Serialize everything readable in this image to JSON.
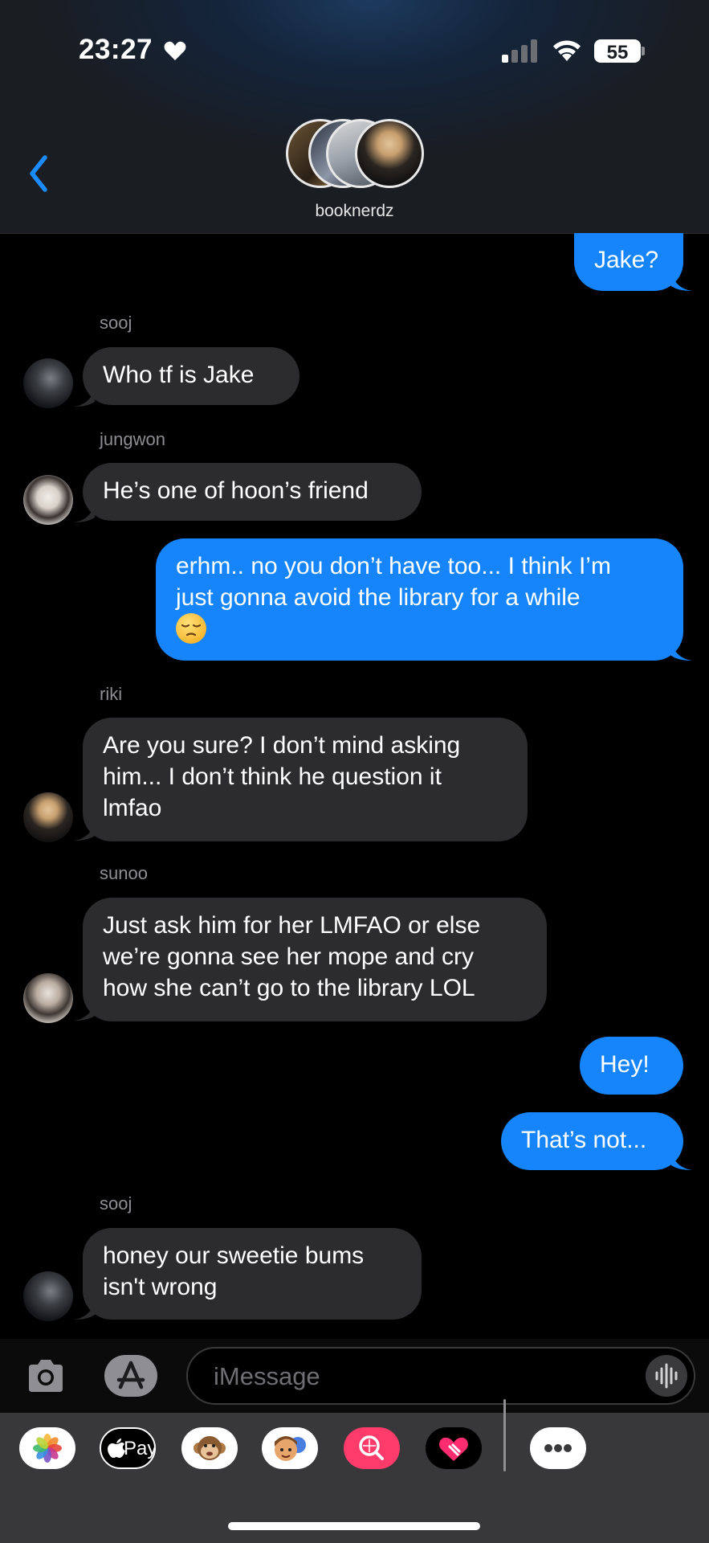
{
  "status_bar": {
    "time": "23:27",
    "battery": "55"
  },
  "header": {
    "group_name": "booknerdz"
  },
  "messages": [
    {
      "from": "me",
      "text": "Jake?"
    },
    {
      "from": "sooj",
      "sender_label": "sooj",
      "text": "Who tf is Jake"
    },
    {
      "from": "jungwon",
      "sender_label": "jungwon",
      "text": "He’s one of hoon’s friend"
    },
    {
      "from": "me",
      "text_line1": "erhm.. no you don’t have too... I think I’m",
      "text_line2": "just gonna avoid the library for a while",
      "emoji": "pensive-face"
    },
    {
      "from": "riki",
      "sender_label": "riki",
      "text_line1": "Are you sure? I don’t mind asking",
      "text_line2": "him... I don’t think he question it",
      "text_line3": "lmfao"
    },
    {
      "from": "sunoo",
      "sender_label": "sunoo",
      "text_line1": "Just ask him for her LMFAO or else",
      "text_line2": "we’re gonna see her mope and cry",
      "text_line3": "how she can’t go to the library LOL"
    },
    {
      "from": "me",
      "text": "Hey!"
    },
    {
      "from": "me",
      "text": "That’s not..."
    },
    {
      "from": "sooj",
      "sender_label": "sooj",
      "text_line1": "honey our sweetie bums",
      "text_line2": "isn't wrong"
    }
  ],
  "input": {
    "placeholder": "iMessage"
  },
  "apps": {
    "pay_label": "Pay",
    "items": [
      "photos-icon",
      "apple-pay-icon",
      "monkey-memoji-icon",
      "memoji-stickers-icon",
      "search-images-icon",
      "digital-touch-icon",
      "more-apps-icon"
    ]
  },
  "colors": {
    "outgoing_bubble": "#1684fa",
    "incoming_bubble": "#2c2c2e",
    "back_chevron": "#1a8cff"
  }
}
